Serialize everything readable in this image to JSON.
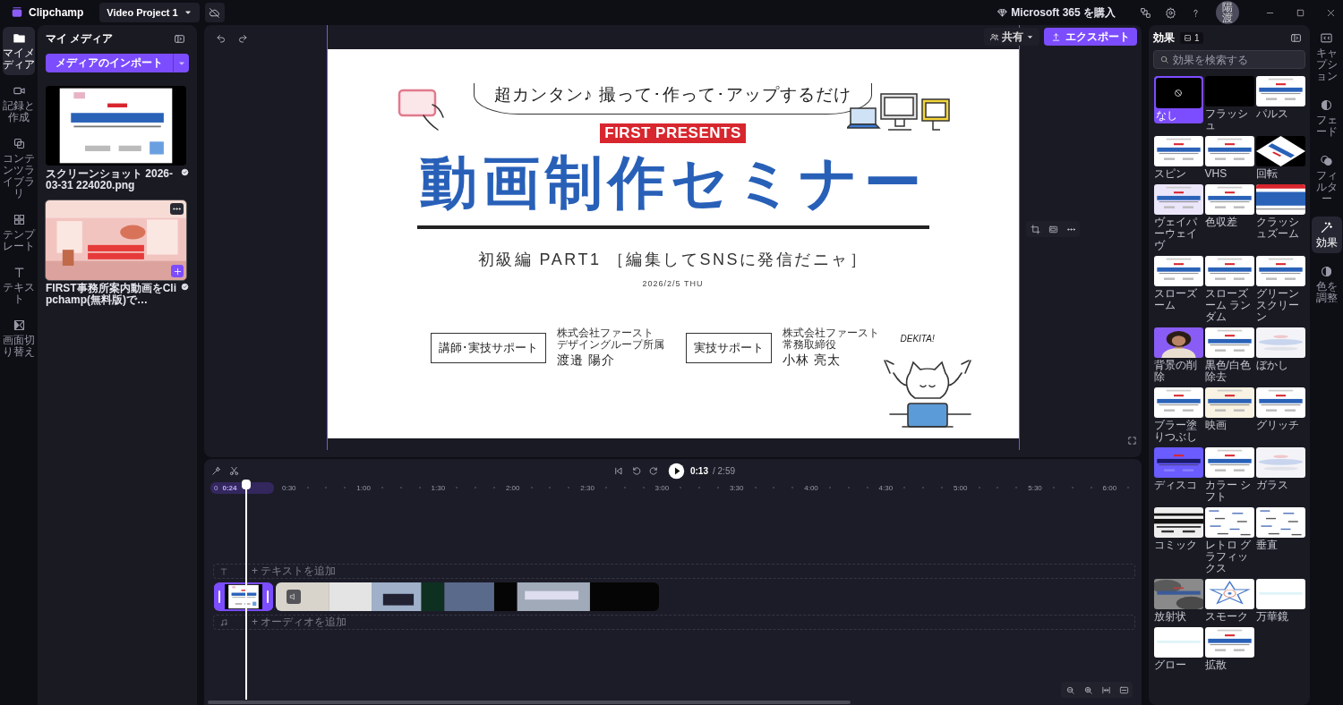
{
  "app_bar": {
    "app_name": "Clipchamp",
    "project_title": "Video Project 1",
    "buy_label": "Microsoft 365 を購入",
    "avatar_initials": "陽渡"
  },
  "left_rail": [
    {
      "label": "マイメディア",
      "kind": "folder",
      "selected": true
    },
    {
      "label": "記録と作成",
      "kind": "camera",
      "selected": false
    },
    {
      "label": "コンテンツライブラリ",
      "kind": "library",
      "selected": false
    },
    {
      "label": "テンプレート",
      "kind": "template",
      "selected": false
    },
    {
      "label": "テキスト",
      "kind": "text",
      "selected": false
    },
    {
      "label": "画面切り替え",
      "kind": "transition",
      "selected": false
    }
  ],
  "media_panel": {
    "title": "マイ メディア",
    "import_button": "メディアのインポート",
    "items": [
      {
        "caption": "スクリーンショット 2026-03-31 224020.png",
        "hovered": false
      },
      {
        "caption": "FIRST事務所案内動画をClipchamp(無料版)で…",
        "hovered": true
      }
    ]
  },
  "preview": {
    "share_button": "共有",
    "export_button": "エクスポート"
  },
  "slide": {
    "tagline": "超カンタン♪ 撮って･作って･アップするだけ",
    "badge": "FIRST PRESENTS",
    "title": "動画制作セミナー",
    "subtitle": "初級編 PART1 ［編集してSNSに発信だニャ］",
    "date": "2026/2/5 THU",
    "presenters": [
      {
        "role": "講師･実技サポート",
        "company": "株式会社ファースト",
        "position": "デザイングループ所属",
        "name": "渡邉 陽介"
      },
      {
        "role": "実技サポート",
        "company": "株式会社ファースト",
        "position": "常務取締役",
        "name": "小林 亮太"
      }
    ],
    "exclamation": "DEKITA!"
  },
  "playback": {
    "current_time": "0:13",
    "total_time": "/ 2:59"
  },
  "timeline": {
    "start_label": "0",
    "selection_label": "0:24",
    "ruler_labels": [
      "0:30",
      "1:00",
      "1:30",
      "2:00",
      "2:30",
      "3:00",
      "3:30",
      "4:00",
      "4:30",
      "5:00",
      "5:30",
      "6:00"
    ],
    "text_track": "+ テキストを追加",
    "audio_track": "+ オーディオを追加",
    "clips": [
      {
        "selected": true
      },
      {
        "selected": false
      }
    ]
  },
  "effects_panel": {
    "title": "効果",
    "count": "1",
    "search": {
      "placeholder": "効果を検索する"
    },
    "effects": [
      {
        "label": "なし",
        "kind": "none",
        "selected": true
      },
      {
        "label": "フラッシュ",
        "kind": "black",
        "selected": false
      },
      {
        "label": "パルス",
        "kind": "picture",
        "selected": false
      },
      {
        "label": "スピン",
        "kind": "picture",
        "selected": false
      },
      {
        "label": "VHS",
        "kind": "picture",
        "selected": false
      },
      {
        "label": "回転",
        "kind": "picture",
        "selected": false
      },
      {
        "label": "ヴェイパーウェイヴ",
        "kind": "picture",
        "selected": false
      },
      {
        "label": "色収差",
        "kind": "picture",
        "selected": false
      },
      {
        "label": "クラッシュズーム",
        "kind": "picture",
        "selected": false
      },
      {
        "label": "スローズーム",
        "kind": "picture",
        "selected": false
      },
      {
        "label": "スローズーム ランダム",
        "kind": "picture",
        "selected": false
      },
      {
        "label": "グリーンスクリーン",
        "kind": "picture",
        "selected": false
      },
      {
        "label": "背景の削除",
        "kind": "picture",
        "selected": false
      },
      {
        "label": "黒色/白色除去",
        "kind": "picture",
        "selected": false
      },
      {
        "label": "ぼかし",
        "kind": "picture",
        "selected": false
      },
      {
        "label": "ブラー塗りつぶし",
        "kind": "picture",
        "selected": false
      },
      {
        "label": "映画",
        "kind": "picture",
        "selected": false
      },
      {
        "label": "グリッチ",
        "kind": "picture",
        "selected": false
      },
      {
        "label": "ディスコ",
        "kind": "picture",
        "selected": false
      },
      {
        "label": "カラー シフト",
        "kind": "picture",
        "selected": false
      },
      {
        "label": "ガラス",
        "kind": "picture",
        "selected": false
      },
      {
        "label": "コミック",
        "kind": "picture",
        "selected": false
      },
      {
        "label": "レトロ グラフィックス",
        "kind": "picture",
        "selected": false
      },
      {
        "label": "垂直",
        "kind": "picture",
        "selected": false
      },
      {
        "label": "放射状",
        "kind": "picture",
        "selected": false
      },
      {
        "label": "スモーク",
        "kind": "picture",
        "selected": false
      },
      {
        "label": "万華鏡",
        "kind": "picture",
        "selected": false
      },
      {
        "label": "グロー",
        "kind": "picture",
        "selected": false
      },
      {
        "label": "拡散",
        "kind": "picture",
        "selected": false
      }
    ]
  },
  "right_rail": [
    {
      "label": "キャプション",
      "kind": "captions",
      "selected": false
    },
    {
      "label": "フェード",
      "kind": "fade",
      "selected": false
    },
    {
      "label": "フィルター",
      "kind": "filter",
      "selected": false
    },
    {
      "label": "効果",
      "kind": "effects",
      "selected": true
    },
    {
      "label": "色を調整",
      "kind": "color",
      "selected": false
    }
  ]
}
